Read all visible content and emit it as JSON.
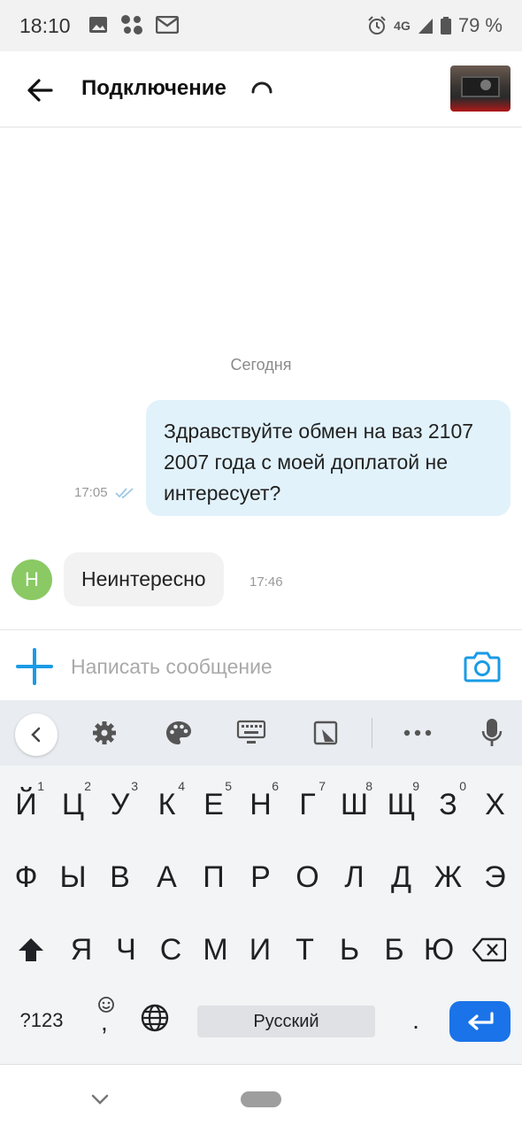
{
  "status_bar": {
    "time": "18:10",
    "network": "4G",
    "battery": "79 %"
  },
  "header": {
    "title": "Подключение",
    "back_icon": "arrow-left-icon",
    "avatar_alt": "car-thumbnail"
  },
  "chat": {
    "date_separator": "Сегодня",
    "outgoing": {
      "text": "Здравствуйте обмен на ваз 2107 2007 года с моей доплатой не интересует?",
      "time": "17:05",
      "status_icon": "double-check-icon"
    },
    "incoming": {
      "avatar_letter": "Н",
      "avatar_color": "#8ac964",
      "text": "Неинтересно",
      "time": "17:46"
    }
  },
  "composer": {
    "placeholder": "Написать сообщение",
    "accent": "#1a9be6"
  },
  "keyboard": {
    "row1": [
      {
        "k": "Й",
        "n": "1"
      },
      {
        "k": "Ц",
        "n": "2"
      },
      {
        "k": "У",
        "n": "3"
      },
      {
        "k": "К",
        "n": "4"
      },
      {
        "k": "Е",
        "n": "5"
      },
      {
        "k": "Н",
        "n": "6"
      },
      {
        "k": "Г",
        "n": "7"
      },
      {
        "k": "Ш",
        "n": "8"
      },
      {
        "k": "Щ",
        "n": "9"
      },
      {
        "k": "З",
        "n": "0"
      },
      {
        "k": "Х",
        "n": ""
      }
    ],
    "row2": [
      "Ф",
      "Ы",
      "В",
      "А",
      "П",
      "Р",
      "О",
      "Л",
      "Д",
      "Ж",
      "Э"
    ],
    "row3": [
      "Я",
      "Ч",
      "С",
      "М",
      "И",
      "Т",
      "Ь",
      "Б",
      "Ю"
    ],
    "symbols_label": "?123",
    "comma": ",",
    "space_label": "Русский",
    "period": ".",
    "enter_color": "#1a73e8"
  }
}
